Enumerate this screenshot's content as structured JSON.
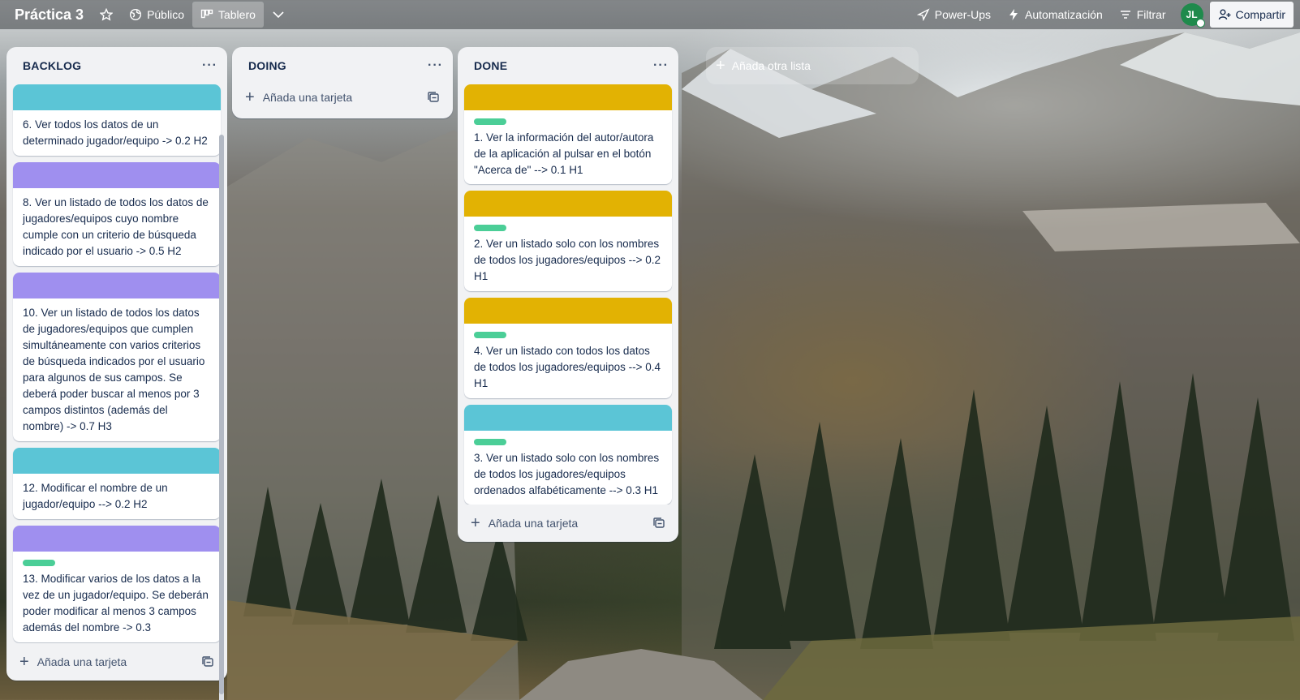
{
  "header": {
    "board_title": "Práctica 3",
    "visibility_label": "Público",
    "view_label": "Tablero",
    "powerups_label": "Power-Ups",
    "automation_label": "Automatización",
    "filter_label": "Filtrar",
    "avatar_initials": "JL",
    "share_label": "Compartir"
  },
  "colors": {
    "teal": "#5bc5d6",
    "purple": "#9f8fef",
    "yellow": "#e2b203",
    "green_label": "#4bce97",
    "avatar": "#1f8a4c"
  },
  "lists": [
    {
      "title": "BACKLOG",
      "menu": "···",
      "add_card_label": "Añada una tarjeta",
      "cards": [
        {
          "cover": "teal",
          "has_label": false,
          "text": "6. Ver todos los datos de un determinado jugador/equipo -> 0.2 H2"
        },
        {
          "cover": "purple",
          "has_label": false,
          "text": "8. Ver un listado de todos los datos de jugadores/equipos cuyo nombre cumple con un criterio de búsqueda indicado por el usuario -> 0.5 H2"
        },
        {
          "cover": "purple",
          "has_label": false,
          "text": "10. Ver un listado de todos los datos de jugadores/equipos que cumplen simultáneamente con varios criterios de búsqueda indicados por el usuario para algunos de sus campos. Se deberá poder buscar al menos por 3 campos distintos (además del nombre) -> 0.7 H3"
        },
        {
          "cover": "teal",
          "has_label": false,
          "text": "12. Modificar el nombre de un jugador/equipo --> 0.2 H2"
        },
        {
          "cover": "purple",
          "has_label": true,
          "text": "13. Modificar varios de los datos a la vez de un jugador/equipo. Se deberán poder modificar al menos 3 campos además del nombre -> 0.3"
        }
      ]
    },
    {
      "title": "DOING",
      "menu": "···",
      "add_card_label": "Añada una tarjeta",
      "cards": []
    },
    {
      "title": "DONE",
      "menu": "···",
      "add_card_label": "Añada una tarjeta",
      "cards": [
        {
          "cover": "yellow",
          "has_label": true,
          "text": "1. Ver la información del autor/autora de la aplicación al pulsar en el botón \"Acerca de\" --> 0.1 H1"
        },
        {
          "cover": "yellow",
          "has_label": true,
          "text": "2. Ver un listado solo con los nombres de todos los jugadores/equipos --> 0.2 H1"
        },
        {
          "cover": "yellow",
          "has_label": true,
          "text": "4. Ver un listado con todos los datos de todos los jugadores/equipos --> 0.4 H1"
        },
        {
          "cover": "teal",
          "has_label": true,
          "text": "3. Ver un listado solo con los nombres de todos los jugadores/equipos ordenados alfabéticamente --> 0.3 H1"
        }
      ]
    }
  ],
  "add_list_label": "Añada otra lista"
}
